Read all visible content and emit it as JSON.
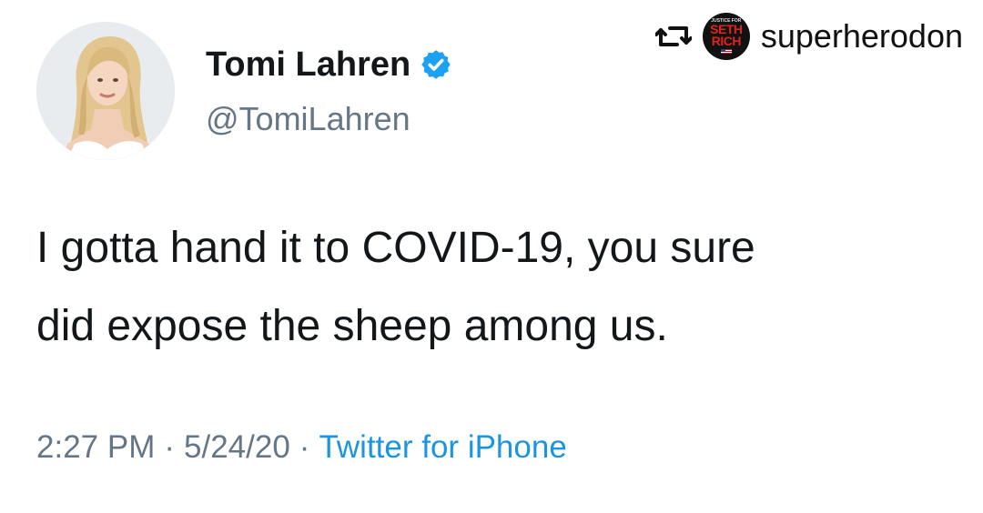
{
  "repost": {
    "icon": "repost-icon",
    "avatar_text_small": "JUSTICE FOR",
    "avatar_text_line1": "SETH",
    "avatar_text_line2": "RICH",
    "username": "superherodon"
  },
  "tweet": {
    "display_name": "Tomi Lahren",
    "verified_icon": "verified-badge-icon",
    "handle": "@TomiLahren",
    "text_line1": "I gotta hand it to COVID-19, you sure",
    "text_line2": "did expose the sheep among us.",
    "time": "2:27 PM",
    "separator": "·",
    "date": "5/24/20",
    "source": "Twitter for iPhone"
  },
  "colors": {
    "text_primary": "#14171a",
    "text_secondary": "#657786",
    "link": "#1b95e0",
    "verified": "#1da1f2",
    "repost_avatar_bg": "#111111",
    "repost_avatar_text": "#e0241b"
  }
}
